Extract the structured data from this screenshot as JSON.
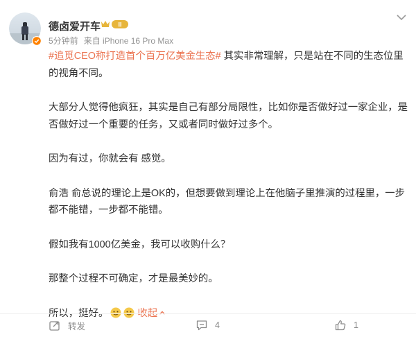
{
  "post": {
    "author": "德卤爱开车",
    "time": "5分钟前",
    "source": "来自 iPhone 16 Pro Max",
    "topic": "#追觅CEO称打造首个百万亿美金生态#",
    "para1_rest": " 其实非常理解，只是站在不同的生态位里的视角不同。",
    "para2": "大部分人觉得他疯狂，其实是自己有部分局限性，比如你是否做好过一家企业，是否做好过一个重要的任务，又或者同时做好过多个。",
    "para3": "因为有过，你就会有 感觉。",
    "para4": "俞浩 俞总说的理论上是OK的，但想要做到理论上在他脑子里推演的过程里，一步都不能错，一步都不能错。",
    "para5": "假如我有1000亿美金，我可以收购什么？",
    "para6": "那整个过程不可确定，才是最美妙的。",
    "para7": "所以，挺好。",
    "collapse_label": "收起",
    "vip_level_text": "II"
  },
  "actions": {
    "repost_label": "转发",
    "comment_count": "4",
    "like_count": "1"
  },
  "colors": {
    "topic": "#eb7350",
    "meta": "#939393",
    "badge_gold": "#e7b53b"
  },
  "icons": [
    "avatar",
    "verified-badge-icon",
    "vip-badge-icon",
    "more-options-icon",
    "smile-emoji-icon",
    "repost-icon",
    "comment-icon",
    "like-icon",
    "chevron-up-icon"
  ]
}
